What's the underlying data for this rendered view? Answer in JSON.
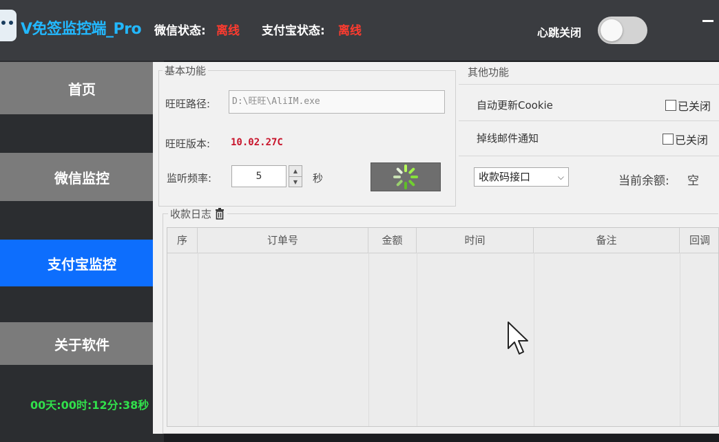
{
  "header": {
    "app_title": "V免签监控端_Pro",
    "wechat_status_label": "微信状态:",
    "wechat_status_value": "离线",
    "alipay_status_label": "支付宝状态:",
    "alipay_status_value": "离线",
    "heartbeat_label": "心跳关闭",
    "heartbeat_on": false
  },
  "sidebar": {
    "items": [
      {
        "label": "首页"
      },
      {
        "label": "微信监控"
      },
      {
        "label": "支付宝监控",
        "active": true
      },
      {
        "label": "关于软件"
      }
    ],
    "uptime": "00天:00时:12分:38秒"
  },
  "basic": {
    "group_title": "基本功能",
    "path_label": "旺旺路径:",
    "path_value": "D:\\旺旺\\AliIM.exe",
    "version_label": "旺旺版本:",
    "version_value": "10.02.27C",
    "freq_label": "监听频率:",
    "freq_value": "5",
    "freq_unit": "秒"
  },
  "other": {
    "group_title": "其他功能",
    "auto_cookie_label": "自动更新Cookie",
    "auto_cookie_state": "已关闭",
    "offline_mail_label": "掉线邮件通知",
    "offline_mail_state": "已关闭",
    "interface_select": "收款码接口",
    "balance_label": "当前余额:",
    "balance_value": "空"
  },
  "log": {
    "group_title": "收款日志",
    "columns": [
      "序",
      "订单号",
      "金额",
      "时间",
      "备注",
      "回调"
    ]
  },
  "colors": {
    "accent": "#0d6efd",
    "status_offline": "#ff3b2f",
    "title": "#22b8ff",
    "uptime": "#31e04b"
  }
}
